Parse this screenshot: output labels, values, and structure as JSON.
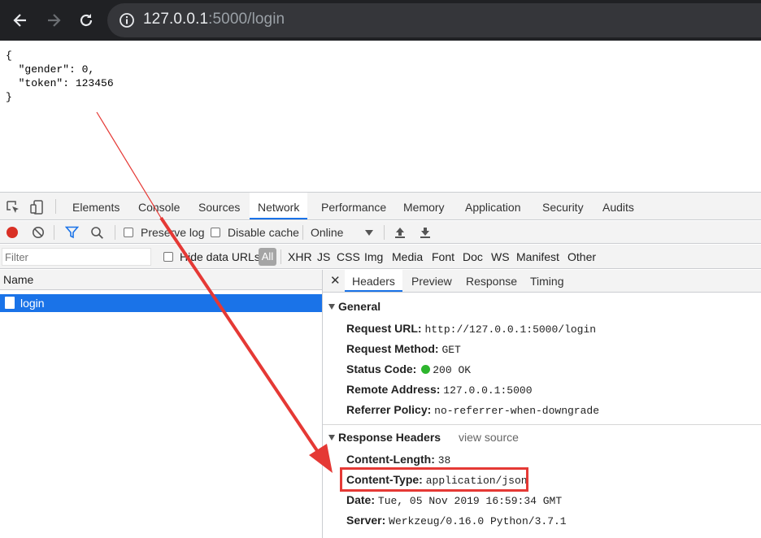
{
  "browser": {
    "url_host": "127.0.0.1",
    "url_path": ":5000/login",
    "icons": {
      "back": "arrow-left-icon",
      "forward": "arrow-right-icon",
      "reload": "reload-icon",
      "site_info": "info-icon"
    }
  },
  "page": {
    "json_lines": [
      "{",
      "  \"gender\": 0,",
      "  \"token\": 123456",
      "}"
    ]
  },
  "devtools": {
    "tabs": [
      "Elements",
      "Console",
      "Sources",
      "Network",
      "Performance",
      "Memory",
      "Application",
      "Security",
      "Audits"
    ],
    "active_tab": "Network",
    "toolbar": {
      "preserve_log": "Preserve log",
      "disable_cache": "Disable cache",
      "throttle": "Online"
    },
    "filter": {
      "placeholder": "Filter",
      "hide_data_urls": "Hide data URLs",
      "types": [
        "All",
        "XHR",
        "JS",
        "CSS",
        "Img",
        "Media",
        "Font",
        "Doc",
        "WS",
        "Manifest",
        "Other"
      ]
    },
    "requests": {
      "column_name": "Name",
      "items": [
        "login"
      ]
    },
    "detail": {
      "tabs": [
        "Headers",
        "Preview",
        "Response",
        "Timing"
      ],
      "active_tab": "Headers",
      "general": {
        "title": "General",
        "request_url_key": "Request URL:",
        "request_url": "http://127.0.0.1:5000/login",
        "request_method_key": "Request Method:",
        "request_method": "GET",
        "status_code_key": "Status Code:",
        "status_code": "200 OK",
        "remote_address_key": "Remote Address:",
        "remote_address": "127.0.0.1:5000",
        "referrer_policy_key": "Referrer Policy:",
        "referrer_policy": "no-referrer-when-downgrade"
      },
      "response_headers": {
        "title": "Response Headers",
        "view_source": "view source",
        "content_length_key": "Content-Length:",
        "content_length": "38",
        "content_type_key": "Content-Type:",
        "content_type": "application/json",
        "date_key": "Date:",
        "date": "Tue, 05 Nov 2019 16:59:34 GMT",
        "server_key": "Server:",
        "server": "Werkzeug/0.16.0 Python/3.7.1"
      }
    }
  },
  "colors": {
    "chrome_dark": "#202124",
    "omnibox": "#35363a",
    "selection_blue": "#1a73e8",
    "record_red": "#d93025",
    "annotation_red": "#e53935",
    "status_green": "#2db52d"
  }
}
